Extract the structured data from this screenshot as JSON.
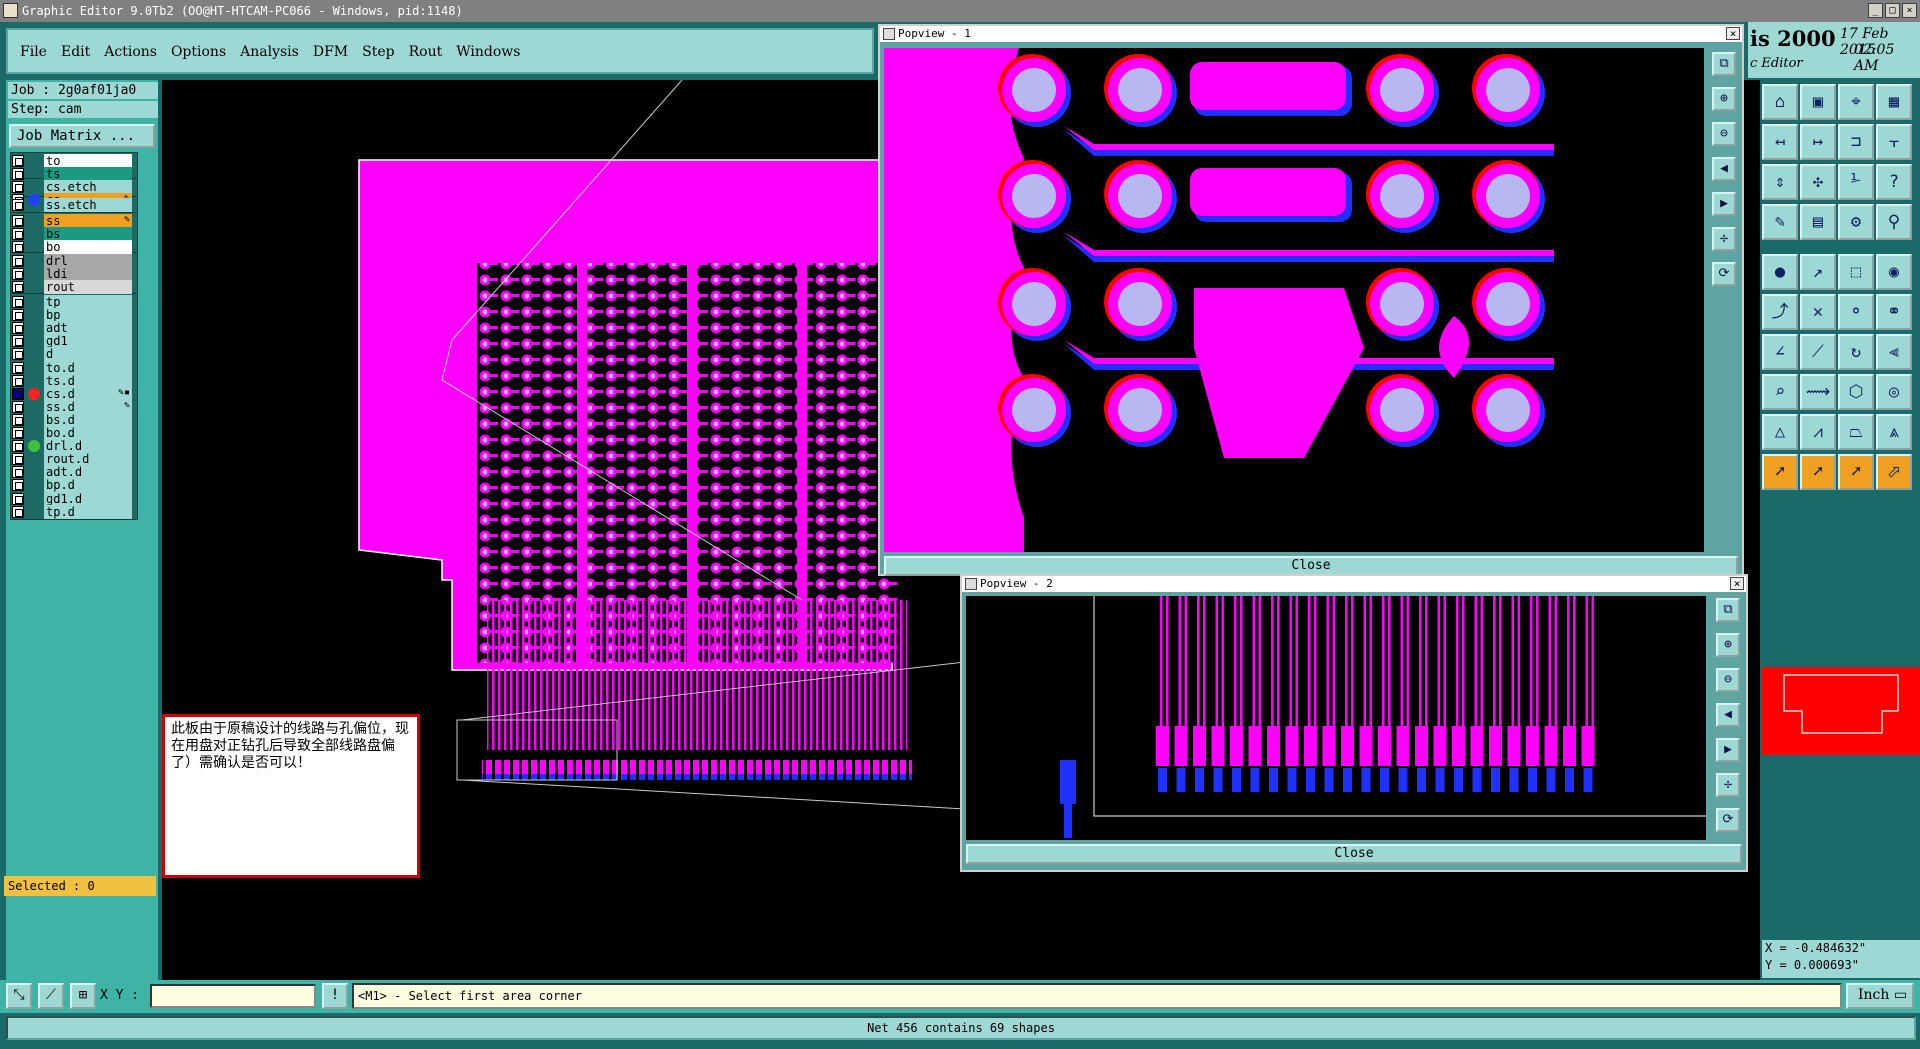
{
  "window": {
    "title": "Graphic Editor 9.0Tb2 (OO@HT-HTCAM-PC066 - Windows, pid:1148)",
    "min": "_",
    "max": "□",
    "close": "×"
  },
  "menu": [
    "File",
    "Edit",
    "Actions",
    "Options",
    "Analysis",
    "DFM",
    "Step",
    "Rout",
    "Windows"
  ],
  "job": {
    "label": "Job : 2g0af01ja0",
    "step": "Step: cam",
    "matrix_button": "Job Matrix ..."
  },
  "layers": [
    {
      "name": "to",
      "bg": "#ffffff",
      "group": 0
    },
    {
      "name": "ts",
      "bg": "#1a9a80",
      "group": 0
    },
    {
      "name": "cs.etch",
      "bg": "#9ed8d4",
      "group": 1
    },
    {
      "name": "cs",
      "bg": "#f0a020",
      "group": 1,
      "dot": "#2040ff",
      "mark": "✎"
    },
    {
      "name": "ss.etch",
      "bg": "#9ed8d4",
      "group": 2
    },
    {
      "name": "ss",
      "bg": "#f0a020",
      "group": 3,
      "mark": "✎"
    },
    {
      "name": "bs",
      "bg": "#1a9a80",
      "group": 3
    },
    {
      "name": "bo",
      "bg": "#ffffff",
      "group": 3
    },
    {
      "name": "drl",
      "bg": "#a8a8a8",
      "group": 4
    },
    {
      "name": "ldi",
      "bg": "#a8a8a8",
      "group": 4
    },
    {
      "name": "rout",
      "bg": "#d8d8d8",
      "group": 4
    },
    {
      "name": "tp",
      "bg": "#9ed8d4",
      "group": 5
    },
    {
      "name": "bp",
      "bg": "#9ed8d4",
      "group": 5
    },
    {
      "name": "adt",
      "bg": "#9ed8d4",
      "group": 5
    },
    {
      "name": "gd1",
      "bg": "#9ed8d4",
      "group": 5
    },
    {
      "name": "d",
      "bg": "#9ed8d4",
      "group": 5
    },
    {
      "name": "to.d",
      "bg": "#9ed8d4",
      "group": 5
    },
    {
      "name": "ts.d",
      "bg": "#9ed8d4",
      "group": 5
    },
    {
      "name": "cs.d",
      "bg": "#9ed8d4",
      "group": 5,
      "dot": "#ff2020",
      "sel": true,
      "mark": "✎▪"
    },
    {
      "name": "ss.d",
      "bg": "#9ed8d4",
      "group": 5,
      "mark": "✎"
    },
    {
      "name": "bs.d",
      "bg": "#9ed8d4",
      "group": 5
    },
    {
      "name": "bo.d",
      "bg": "#9ed8d4",
      "group": 5
    },
    {
      "name": "drl.d",
      "bg": "#9ed8d4",
      "group": 5,
      "dot": "#40c040"
    },
    {
      "name": "rout.d",
      "bg": "#9ed8d4",
      "group": 5
    },
    {
      "name": "adt.d",
      "bg": "#9ed8d4",
      "group": 5
    },
    {
      "name": "bp.d",
      "bg": "#9ed8d4",
      "group": 5
    },
    {
      "name": "gd1.d",
      "bg": "#9ed8d4",
      "group": 5
    },
    {
      "name": "tp.d",
      "bg": "#9ed8d4",
      "group": 5
    }
  ],
  "selected": "Selected : 0",
  "note": "此板由于原稿设计的线路与孔偏位，现在用盘对正钻孔后导致全部线路盘偏了）需确认是否可以！",
  "popview1": {
    "title": "Popview - 1",
    "close": "Close"
  },
  "popview2": {
    "title": "Popview - 2",
    "close": "Close"
  },
  "brand": {
    "title": "is 2000",
    "date": "17 Feb 2015",
    "time": "02:05 AM",
    "sub": "c Editor"
  },
  "coords": {
    "x": "X = -0.484632\"",
    "y": "Y = 0.000693\""
  },
  "xy_label": "X Y :",
  "xy_value": "",
  "prompt": "<M1> - Select first area corner",
  "unit": "Inch",
  "status": "Net 456 contains 69 shapes",
  "colors": {
    "copper": "#ff00ff",
    "drill": "#b8b8f0",
    "edge_red": "#ff0000",
    "edge_blue": "#2030ff",
    "panel": "#9ed8d4",
    "accent": "#f0a020"
  },
  "icons": {
    "pop_tools": [
      "fit-icon",
      "zoom-in-icon",
      "zoom-out-icon",
      "pan-left-icon",
      "pan-right-icon",
      "zoom-box-icon",
      "redraw-icon"
    ],
    "right_tools": [
      "home-icon",
      "save-icon",
      "layers-icon",
      "grid-icon",
      "move-icon",
      "copy-icon",
      "snap-icon",
      "measure-icon",
      "resize-icon",
      "center-icon",
      "scale-icon",
      "help-icon",
      "edit-icon",
      "table-icon",
      "tool-icon",
      "net-icon",
      "pad-icon",
      "line-icon",
      "arc-icon",
      "surface-icon",
      "node-icon",
      "delete-icon",
      "connect-icon",
      "join-icon",
      "draw-icon",
      "slope-icon",
      "rotate-icon",
      "fillet-icon",
      "fix-icon",
      "route-icon",
      "bound-icon",
      "drill-icon",
      "cross-icon",
      "cut-icon",
      "neck-icon",
      "ring-icon",
      "select-icon",
      "pick-icon",
      "area-icon",
      "pointer-icon"
    ]
  }
}
